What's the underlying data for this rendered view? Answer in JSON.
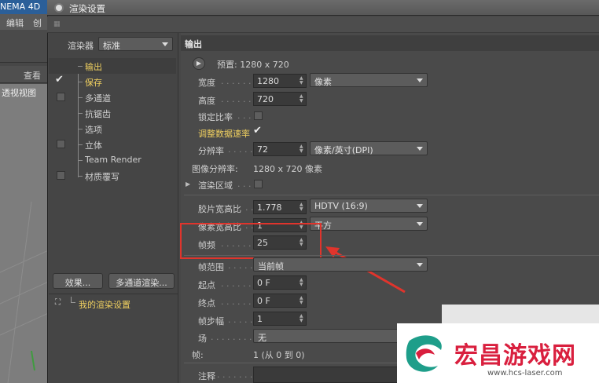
{
  "background_app": {
    "title": "NEMA 4D",
    "menu": [
      "编辑",
      "创"
    ],
    "view_tab": "查看",
    "viewport_label": "透视视图"
  },
  "dialog": {
    "title": "渲染设置",
    "renderer_label": "渲染器",
    "renderer_value": "标准",
    "tree": [
      {
        "label": "输出",
        "checked": null,
        "highlight": true
      },
      {
        "label": "保存",
        "checked": true,
        "highlight": true
      },
      {
        "label": "多通道",
        "checked": false,
        "highlight": false
      },
      {
        "label": "抗锯齿",
        "checked": null,
        "highlight": false
      },
      {
        "label": "选项",
        "checked": null,
        "highlight": false
      },
      {
        "label": "立体",
        "checked": false,
        "highlight": false
      },
      {
        "label": "Team Render",
        "checked": null,
        "highlight": false
      },
      {
        "label": "材质覆写",
        "checked": false,
        "highlight": false
      }
    ],
    "effects_button": "效果...",
    "multipass_button": "多通道渲染...",
    "my_render_settings": "我的渲染设置",
    "section_title": "输出",
    "preset": "预置: 1280 x 720",
    "width_label": "宽度",
    "width_value": "1280",
    "unit_value": "像素",
    "height_label": "高度",
    "height_value": "720",
    "lock_ratio_label": "锁定比率",
    "adjust_rate_label": "调整数据速率",
    "resolution_label": "分辨率",
    "resolution_value": "72",
    "resolution_unit": "像素/英寸(DPI)",
    "image_res_label": "图像分辨率:",
    "image_res_value": "1280 x 720 像素",
    "render_region_label": "渲染区域",
    "film_aspect_label": "胶片宽高比",
    "film_aspect_value": "1.778",
    "film_aspect_preset": "HDTV (16:9)",
    "pixel_aspect_label": "像素宽高比",
    "pixel_aspect_value": "1",
    "pixel_aspect_preset": "平方",
    "fps_label": "帧频",
    "fps_value": "25",
    "frame_range_label": "帧范围",
    "frame_range_value": "当前帧",
    "start_label": "起点",
    "start_value": "0 F",
    "end_label": "终点",
    "end_value": "0 F",
    "step_label": "帧步幅",
    "step_value": "1",
    "field_label": "场",
    "field_value": "无",
    "frames_label": "帧:",
    "frames_value": "1 (从 0 到 0)",
    "notes_label": "注释"
  },
  "watermark": {
    "text": "宏昌游戏网",
    "url": "www.hcs-laser.com"
  },
  "colors": {
    "highlight": "#f0d060",
    "annotation": "#e0342c"
  }
}
